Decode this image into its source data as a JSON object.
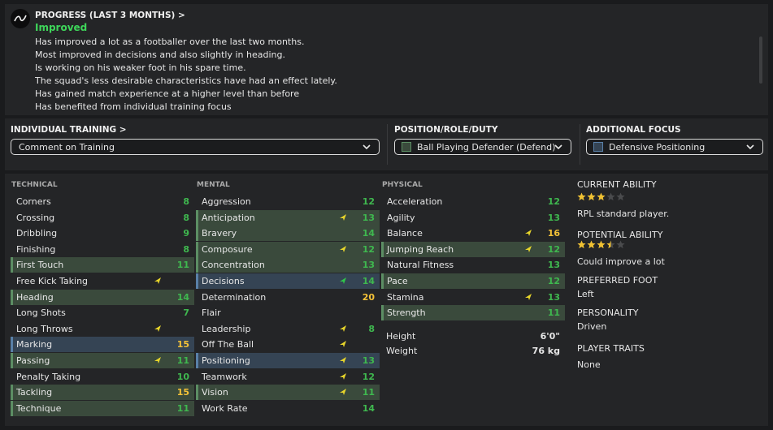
{
  "progress": {
    "title": "PROGRESS (LAST 3 MONTHS) >",
    "status": "Improved",
    "lines": [
      "Has improved a lot as a footballer over the last two months.",
      "Most improved in decisions and also slightly in heading.",
      "Is working on his weaker foot in his spare time.",
      "The squad's less desirable characteristics have had an effect lately.",
      "Has gained match experience at a higher level than before",
      "Has benefited from individual training focus"
    ]
  },
  "controls": {
    "training_label": "INDIVIDUAL TRAINING >",
    "training_value": "Comment on Training",
    "role_label": "POSITION/ROLE/DUTY",
    "role_value": "Ball Playing Defender (Defend)",
    "focus_label": "ADDITIONAL FOCUS",
    "focus_value": "Defensive Positioning"
  },
  "technical": {
    "header": "TECHNICAL",
    "rows": [
      {
        "name": "Corners",
        "value": "8",
        "color": "g",
        "hl": "",
        "arrow": ""
      },
      {
        "name": "Crossing",
        "value": "8",
        "color": "g",
        "hl": "",
        "arrow": ""
      },
      {
        "name": "Dribbling",
        "value": "9",
        "color": "g",
        "hl": "",
        "arrow": ""
      },
      {
        "name": "Finishing",
        "value": "8",
        "color": "g",
        "hl": "",
        "arrow": ""
      },
      {
        "name": "First Touch",
        "value": "11",
        "color": "g",
        "hl": "g",
        "arrow": ""
      },
      {
        "name": "Free Kick Taking",
        "value": "",
        "color": "g",
        "hl": "",
        "arrow": "up"
      },
      {
        "name": "Heading",
        "value": "14",
        "color": "g",
        "hl": "g",
        "arrow": ""
      },
      {
        "name": "Long Shots",
        "value": "7",
        "color": "g",
        "hl": "",
        "arrow": ""
      },
      {
        "name": "Long Throws",
        "value": "",
        "color": "g",
        "hl": "",
        "arrow": "up"
      },
      {
        "name": "Marking",
        "value": "15",
        "color": "y",
        "hl": "b",
        "arrow": ""
      },
      {
        "name": "Passing",
        "value": "11",
        "color": "g",
        "hl": "g",
        "arrow": "up"
      },
      {
        "name": "Penalty Taking",
        "value": "10",
        "color": "g",
        "hl": "",
        "arrow": ""
      },
      {
        "name": "Tackling",
        "value": "15",
        "color": "y",
        "hl": "g",
        "arrow": ""
      },
      {
        "name": "Technique",
        "value": "11",
        "color": "g",
        "hl": "g",
        "arrow": ""
      }
    ]
  },
  "mental": {
    "header": "MENTAL",
    "rows": [
      {
        "name": "Aggression",
        "value": "12",
        "color": "g",
        "hl": "",
        "arrow": ""
      },
      {
        "name": "Anticipation",
        "value": "13",
        "color": "g",
        "hl": "g",
        "arrow": "up"
      },
      {
        "name": "Bravery",
        "value": "14",
        "color": "g",
        "hl": "g",
        "arrow": ""
      },
      {
        "name": "Composure",
        "value": "12",
        "color": "g",
        "hl": "g",
        "arrow": "up"
      },
      {
        "name": "Concentration",
        "value": "13",
        "color": "g",
        "hl": "g",
        "arrow": ""
      },
      {
        "name": "Decisions",
        "value": "14",
        "color": "g",
        "hl": "b",
        "arrow": "upg"
      },
      {
        "name": "Determination",
        "value": "20",
        "color": "y",
        "hl": "",
        "arrow": ""
      },
      {
        "name": "Flair",
        "value": "",
        "color": "g",
        "hl": "",
        "arrow": ""
      },
      {
        "name": "Leadership",
        "value": "8",
        "color": "g",
        "hl": "",
        "arrow": "up"
      },
      {
        "name": "Off The Ball",
        "value": "",
        "color": "g",
        "hl": "",
        "arrow": "up"
      },
      {
        "name": "Positioning",
        "value": "13",
        "color": "g",
        "hl": "b",
        "arrow": "up"
      },
      {
        "name": "Teamwork",
        "value": "12",
        "color": "g",
        "hl": "",
        "arrow": "up"
      },
      {
        "name": "Vision",
        "value": "11",
        "color": "g",
        "hl": "g",
        "arrow": "up"
      },
      {
        "name": "Work Rate",
        "value": "14",
        "color": "g",
        "hl": "",
        "arrow": ""
      }
    ]
  },
  "physical": {
    "header": "PHYSICAL",
    "rows": [
      {
        "name": "Acceleration",
        "value": "12",
        "color": "g",
        "hl": "",
        "arrow": ""
      },
      {
        "name": "Agility",
        "value": "13",
        "color": "g",
        "hl": "",
        "arrow": ""
      },
      {
        "name": "Balance",
        "value": "16",
        "color": "y",
        "hl": "",
        "arrow": "up"
      },
      {
        "name": "Jumping Reach",
        "value": "12",
        "color": "g",
        "hl": "g",
        "arrow": "up"
      },
      {
        "name": "Natural Fitness",
        "value": "13",
        "color": "g",
        "hl": "",
        "arrow": ""
      },
      {
        "name": "Pace",
        "value": "12",
        "color": "g",
        "hl": "g",
        "arrow": ""
      },
      {
        "name": "Stamina",
        "value": "13",
        "color": "g",
        "hl": "",
        "arrow": "up"
      },
      {
        "name": "Strength",
        "value": "11",
        "color": "g",
        "hl": "g",
        "arrow": ""
      }
    ],
    "height_label": "Height",
    "height_value": "6'0\"",
    "weight_label": "Weight",
    "weight_value": "76 kg"
  },
  "info": {
    "ca_label": "CURRENT ABILITY",
    "ca_stars": 3,
    "ca_text": "RPL standard player.",
    "pa_label": "POTENTIAL ABILITY",
    "pa_stars": 3.5,
    "pa_text": "Could improve a lot",
    "foot_label": "PREFERRED FOOT",
    "foot_value": "Left",
    "personality_label": "PERSONALITY",
    "personality_value": "Driven",
    "traits_label": "PLAYER TRAITS",
    "traits_value": "None"
  },
  "colors": {
    "value_green": "#3fb84f",
    "value_yellow": "#f4c238",
    "improved_green": "#3ed65a",
    "arrow_yellow": "#e8d62b",
    "arrow_green": "#2fc64a",
    "star_gold": "#f1c232"
  }
}
